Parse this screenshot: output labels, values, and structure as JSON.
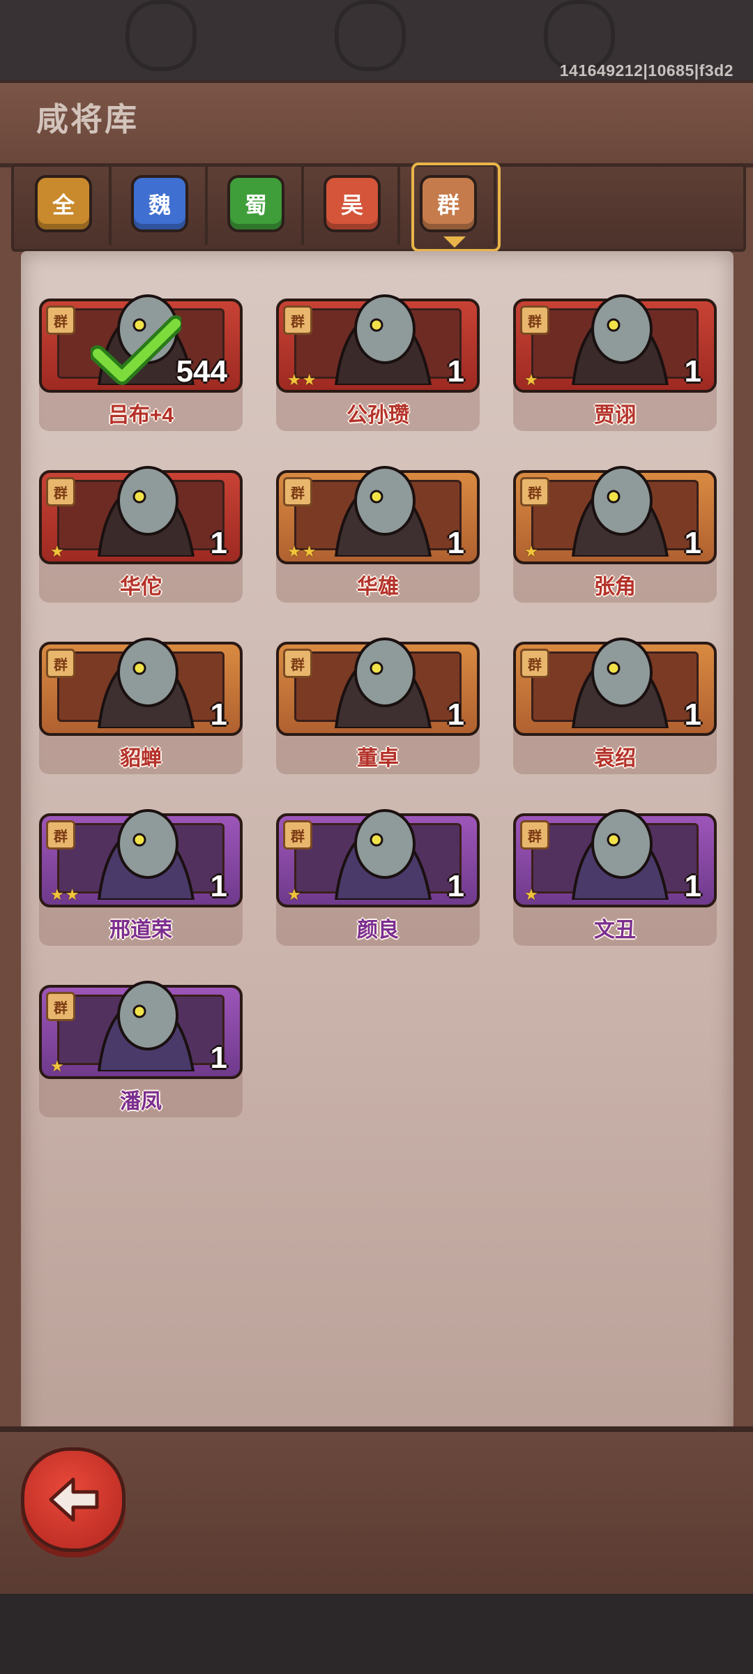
{
  "build_id": "141649212|10685|f3d2",
  "title": "咸将库",
  "tabs": [
    {
      "label": "全",
      "color": "#c98a2d"
    },
    {
      "label": "魏",
      "color": "#3f6fd0"
    },
    {
      "label": "蜀",
      "color": "#3f9e3a"
    },
    {
      "label": "吴",
      "color": "#d4553a"
    },
    {
      "label": "群",
      "color": "#c57b4b",
      "selected": true
    }
  ],
  "faction_badge": "群",
  "cards": [
    {
      "name": "吕布+4",
      "count": "544",
      "stars": 0,
      "rarity": "red",
      "owned_check": true
    },
    {
      "name": "公孙瓒",
      "count": "1",
      "stars": 2,
      "rarity": "red"
    },
    {
      "name": "贾诩",
      "count": "1",
      "stars": 1,
      "rarity": "red"
    },
    {
      "name": "华佗",
      "count": "1",
      "stars": 1,
      "rarity": "red"
    },
    {
      "name": "华雄",
      "count": "1",
      "stars": 2,
      "rarity": "orange"
    },
    {
      "name": "张角",
      "count": "1",
      "stars": 1,
      "rarity": "orange"
    },
    {
      "name": "貂蝉",
      "count": "1",
      "stars": 0,
      "rarity": "orange"
    },
    {
      "name": "董卓",
      "count": "1",
      "stars": 0,
      "rarity": "orange"
    },
    {
      "name": "袁绍",
      "count": "1",
      "stars": 0,
      "rarity": "orange"
    },
    {
      "name": "邢道荣",
      "count": "1",
      "stars": 2,
      "rarity": "purple"
    },
    {
      "name": "颜良",
      "count": "1",
      "stars": 1,
      "rarity": "purple"
    },
    {
      "name": "文丑",
      "count": "1",
      "stars": 1,
      "rarity": "purple"
    },
    {
      "name": "潘凤",
      "count": "1",
      "stars": 1,
      "rarity": "purple"
    }
  ],
  "back_button_icon": "back-arrow-icon"
}
